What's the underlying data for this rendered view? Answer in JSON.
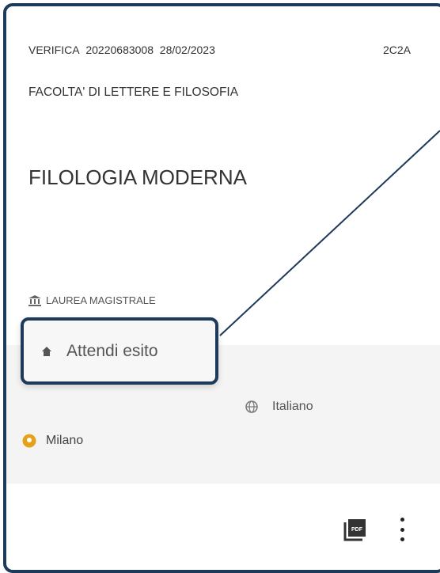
{
  "header": {
    "verification_label": "VERIFICA",
    "verification_number": "20220683008",
    "date": "28/02/2023",
    "code": "2C2A"
  },
  "faculty": "FACOLTA' DI LETTERE E FILOSOFIA",
  "course": "FILOLOGIA MODERNA",
  "degree": "LAUREA MAGISTRALE",
  "status": "Attendi esito",
  "language": "Italiano",
  "city": "Milano",
  "icons": {
    "degree": "institution-icon",
    "status": "home-icon",
    "language": "globe-icon",
    "city": "location-pin-icon",
    "pdf": "pdf-icon",
    "menu": "more-vertical-icon"
  },
  "colors": {
    "frame": "#1e3a5a",
    "pin": "#e3a21a",
    "band": "#f4f4f4"
  }
}
